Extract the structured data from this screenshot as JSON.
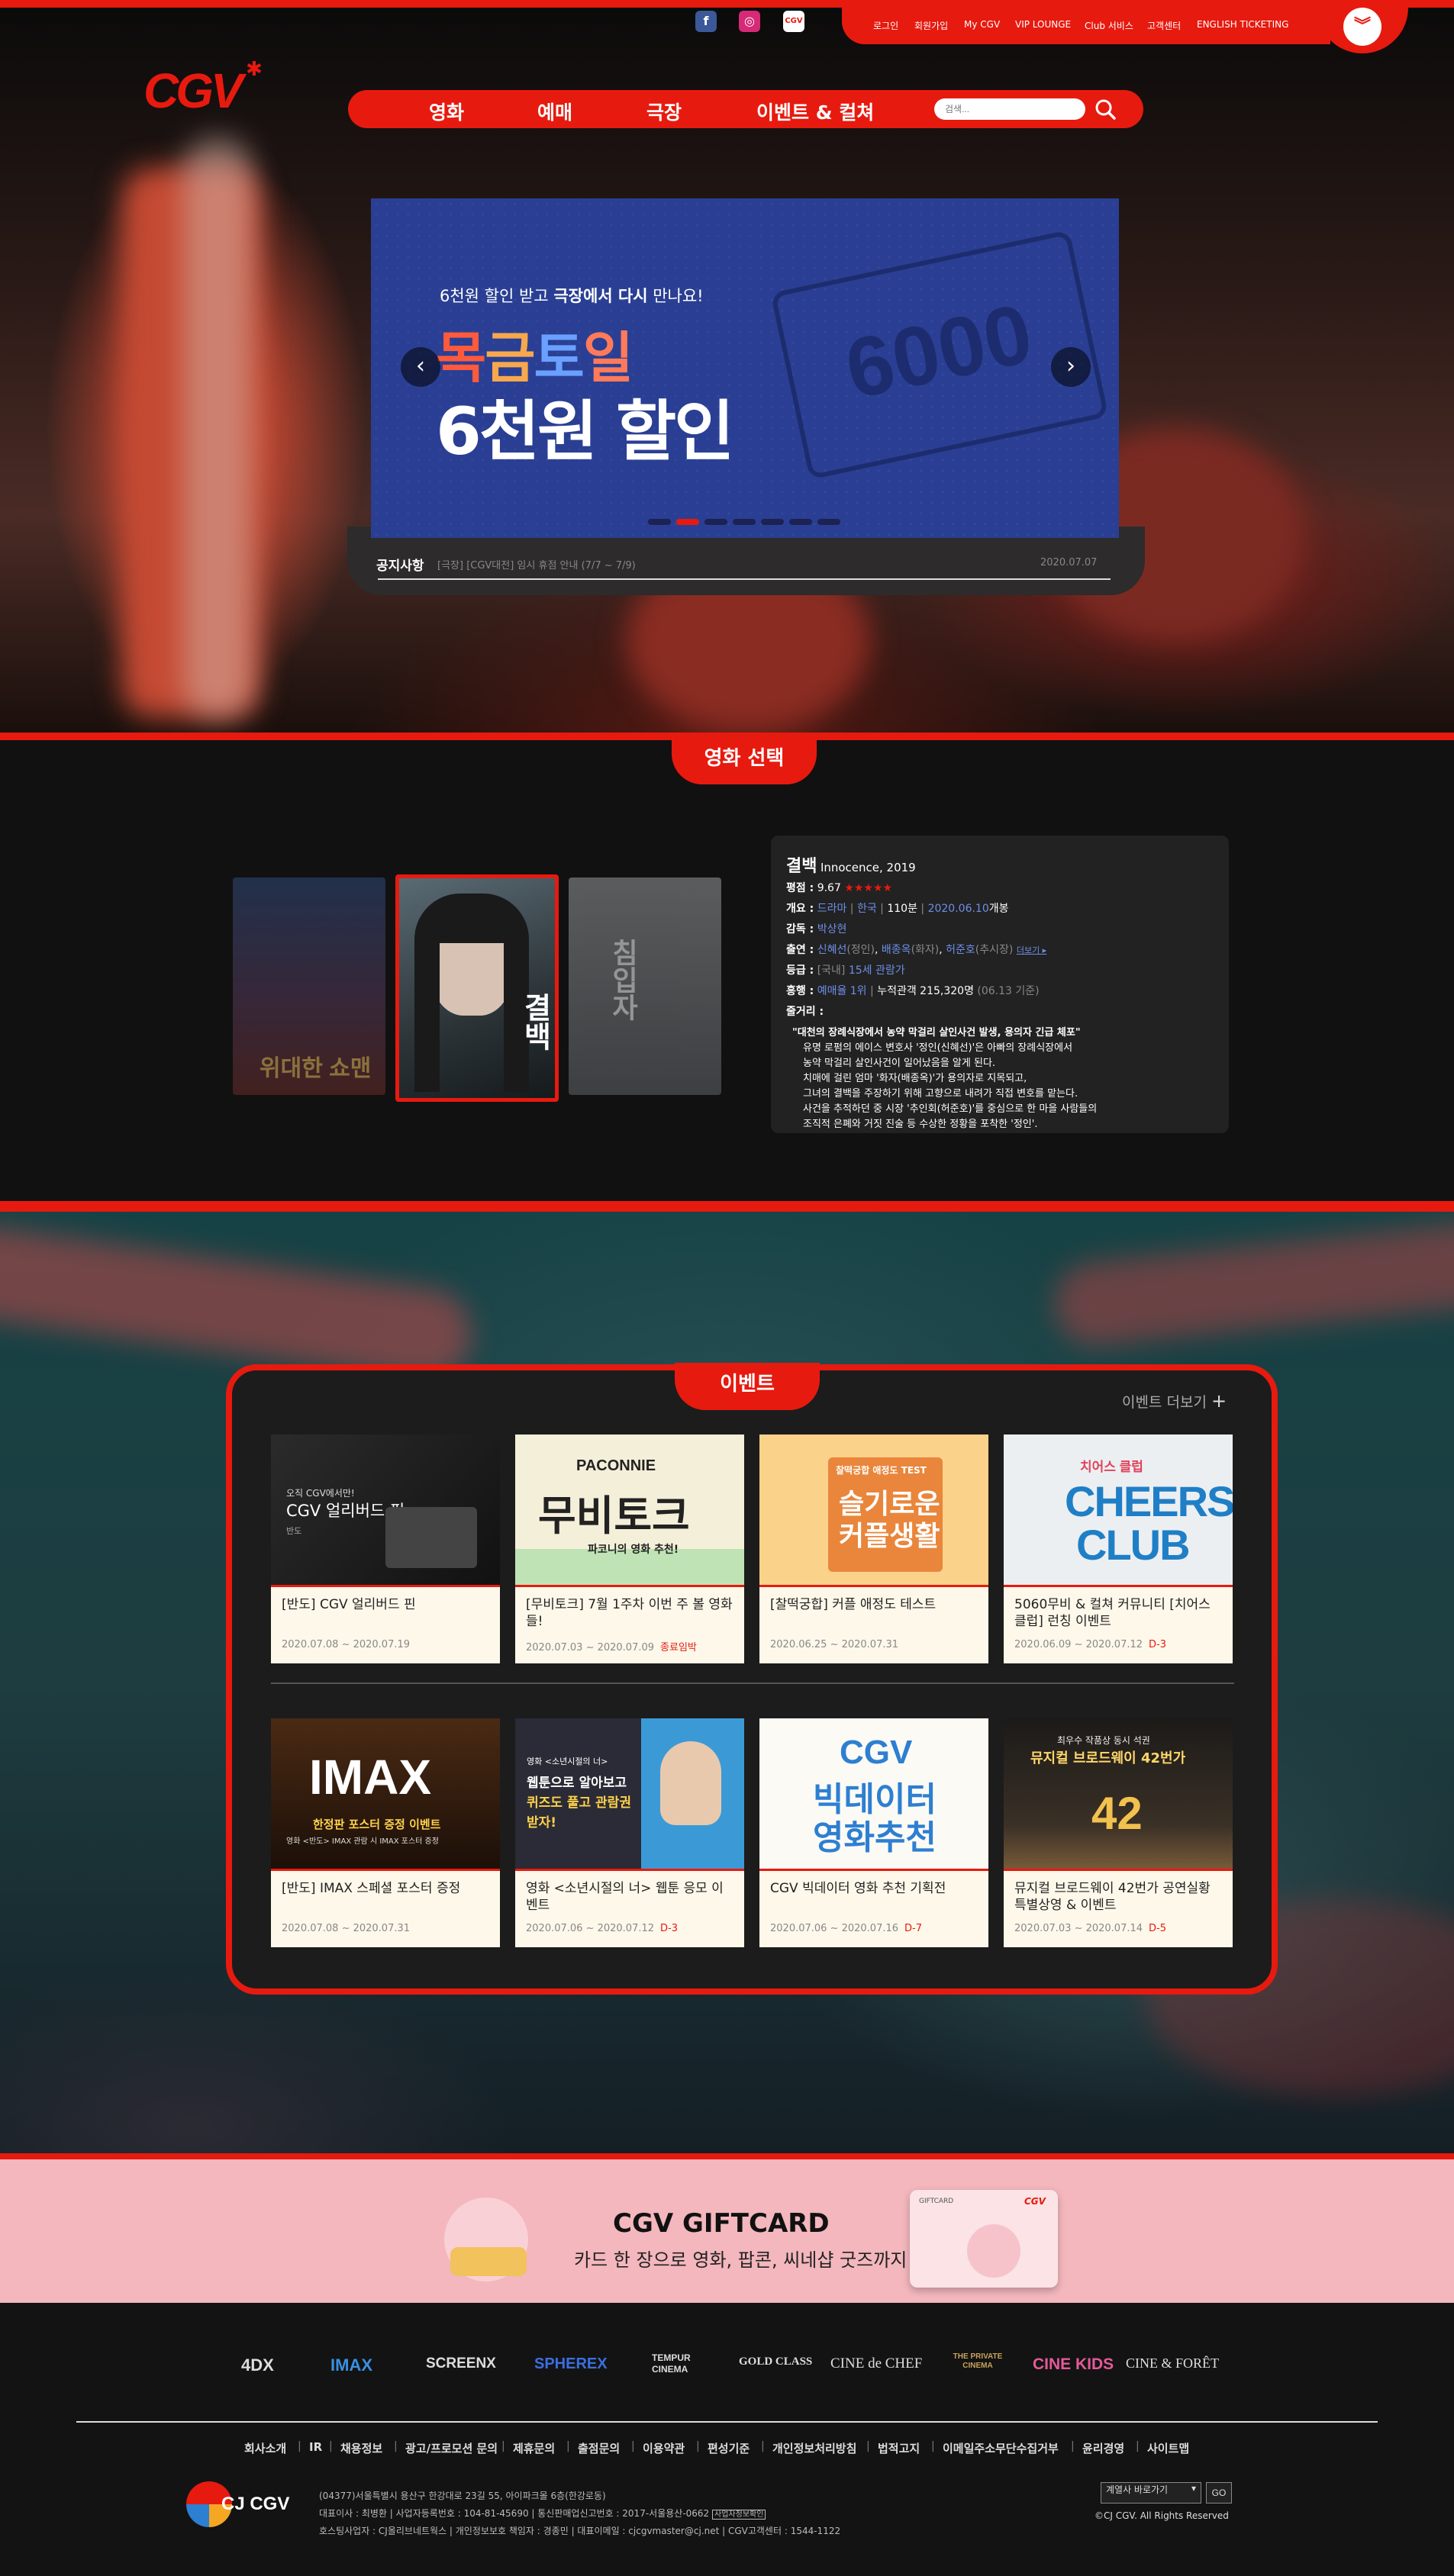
{
  "colors": {
    "brand": "#e71a0f",
    "banner_bg": "#2a3f93",
    "gift_bg": "#f3b7bd"
  },
  "util": {
    "social": [
      "facebook-icon",
      "instagram-icon",
      "cgv-app-icon"
    ],
    "links": [
      "로그인",
      "회원가입",
      "My CGV",
      "VIP LOUNGE",
      "Club 서비스",
      "고객센터",
      "ENGLISH TICKETING"
    ]
  },
  "logo": {
    "text": "CGV"
  },
  "nav": {
    "items": [
      "영화",
      "예매",
      "극장",
      "이벤트 & 컬쳐"
    ],
    "search_placeholder": "검색..."
  },
  "banner": {
    "subtitle_pre": "6천원 할인 받고 ",
    "subtitle_bold": "극장에서 다시",
    "subtitle_post": " 만나요!",
    "days": [
      "목",
      "금",
      "토",
      "일"
    ],
    "title2": "6천원 할인",
    "ticket_num": "6000",
    "slide_count": 7,
    "active_slide": 2
  },
  "notice": {
    "label": "공지사항",
    "text": "[극장] [CGV대전] 임시 휴점 안내 (7/7 ~ 7/9)",
    "date": "2020.07.07"
  },
  "movie": {
    "section_title": "영화 선택",
    "posters": [
      {
        "name": "위대한 쇼맨"
      },
      {
        "name": "결백"
      },
      {
        "name": "침입자"
      }
    ],
    "title": "결백",
    "title_en": "Innocence, 2019",
    "rating_label": "평점 :",
    "rating": "9.67",
    "stars": "★★★★★",
    "summary_label": "개요 :",
    "genre": "드라마",
    "country": "한국",
    "runtime": "110분",
    "release": "2020.06.10",
    "release_suffix": "개봉",
    "director_label": "감독 :",
    "director": "박상현",
    "cast_label": "출연 :",
    "cast1": "신혜선",
    "cast1_role": "(정인)",
    "cast2": "배종옥",
    "cast2_role": "(화자)",
    "cast3": "허준호",
    "cast3_role": "(추시장)",
    "more": "더보기 ▸",
    "grade_label": "등급 :",
    "grade_pre": "[국내]",
    "grade": "15세 관람가",
    "boxoffice_label": "흥행 :",
    "boxoffice_rank": "예매율 1위",
    "boxoffice_total": "누적관객 215,320명",
    "boxoffice_date": "(06.13 기준)",
    "plot_label": "줄거리 :",
    "plot_headline": "\"대천의 장례식장에서 농약 막걸리 살인사건 발생, 용의자 긴급 체포\"",
    "plot_lines": [
      "유명 로펌의 에이스 변호사 '정인(신혜선)'은 아빠의 장례식장에서",
      "농약 막걸리 살인사건이 일어났음을 알게 된다.",
      "치매에 걸린 엄마 '화자(배종옥)'가 용의자로 지목되고,",
      "그녀의 결백을 주장하기 위해 고향으로 내려가 직접 변호를 맡는다.",
      "사건을 추적하던 중 시장 '추인회(허준호)'를 중심으로 한 마을 사람들의",
      "조직적 은폐와 거짓 진술 등 수상한 정황을 포착한 '정인'."
    ]
  },
  "events": {
    "section_title": "이벤트",
    "more": "이벤트 더보기",
    "cards": [
      {
        "title": "[반도] CGV 얼리버드 핀",
        "date": "2020.07.08 ~ 2020.07.19",
        "flag": "",
        "img_line1": "오직 CGV에서만!",
        "img_line2": "CGV 얼리버드 핀",
        "img_line3": "반도"
      },
      {
        "title": "[무비토크] 7월 1주차 이번 주 볼 영화들!",
        "date": "2020.07.03 ~ 2020.07.09",
        "flag": "종료임박",
        "img_line1": "PACONNIE",
        "img_line2": "무비토크",
        "img_line3": "파코니의 영화 추천!"
      },
      {
        "title": "[찰떡궁합] 커플 애정도 테스트",
        "date": "2020.06.25 ~ 2020.07.31",
        "flag": "",
        "img_line1": "찰떡궁합 애정도 TEST",
        "img_line2": "슬기로운",
        "img_line3": "커플생활"
      },
      {
        "title": "5060무비 & 컬쳐 커뮤니티 [치어스 클럽] 런칭 이벤트",
        "date": "2020.06.09 ~ 2020.07.12",
        "flag": "D-3",
        "img_line1": "치어스 클럽",
        "img_line2": "CHEERS",
        "img_line3": "CLUB"
      },
      {
        "title": "[반도] IMAX 스페셜 포스터 증정",
        "date": "2020.07.08 ~ 2020.07.31",
        "flag": "",
        "img_line1": "IMAX",
        "img_line2": "한정판 포스터 증정 이벤트",
        "img_line3": "영화 <반도> IMAX 관람 시 IMAX 포스터 증정"
      },
      {
        "title": "영화 <소년시절의 너> 웹툰 응모 이벤트",
        "date": "2020.07.06 ~ 2020.07.12",
        "flag": "D-3",
        "img_line1": "영화 <소년시절의 너>",
        "img_line2": "웹툰으로 알아보고",
        "img_line3": "퀴즈도 풀고 관람권 받자!"
      },
      {
        "title": "CGV 빅데이터 영화 추천 기획전",
        "date": "2020.07.06 ~ 2020.07.16",
        "flag": "D-7",
        "img_line1": "CGV",
        "img_line2": "빅데이터",
        "img_line3": "영화추천"
      },
      {
        "title": "뮤지컬 브로드웨이 42번가 공연실황 특별상영 & 이벤트",
        "date": "2020.07.03 ~ 2020.07.14",
        "flag": "D-5",
        "img_line1": "최우수 작품상 동시 석권",
        "img_line2": "뮤지컬 브로드웨이 42번가",
        "img_line3": "42"
      }
    ]
  },
  "gift": {
    "title": "CGV GIFTCARD",
    "subtitle": "카드 한 장으로 영화, 팝콘, 씨네샵 굿즈까지!",
    "card_label": "GIFTCARD"
  },
  "footer": {
    "brands": [
      "4DX",
      "IMAX",
      "SCREENX",
      "SPHEREX",
      "TEMPUR CINEMA",
      "GOLD CLASS",
      "CINE de CHEF",
      "THE PRIVATE CINEMA",
      "CINE KIDS",
      "CINE & FORÊT"
    ],
    "links": [
      "회사소개",
      "IR",
      "채용정보",
      "광고/프로모션 문의",
      "제휴문의",
      "출점문의",
      "이용약관",
      "편성기준",
      "개인정보처리방침",
      "법적고지",
      "이메일주소무단수집거부",
      "윤리경영",
      "사이트맵"
    ],
    "logo_text": "CJ CGV",
    "addr1": "(04377)서울특별시 용산구 한강대로 23길 55, 아이파크몰 6층(한강로동)",
    "addr2": "대표이사 : 최병환  |  사업자등록번호 : 104-81-45690  |  통신판매업신고번호 : 2017-서울용산-0662",
    "addr2_btn": "사업자정보확인",
    "addr3": "호스팅사업자 : CJ올리브네트웍스  |  개인정보보호 책임자 : 경종민  |  대표이메일 : cjcgvmaster@cj.net  |  CGV고객센터 : 1544-1122",
    "family_select": "계열사 바로가기",
    "go": "GO",
    "copyright": "©CJ CGV. All Rights Reserved"
  }
}
